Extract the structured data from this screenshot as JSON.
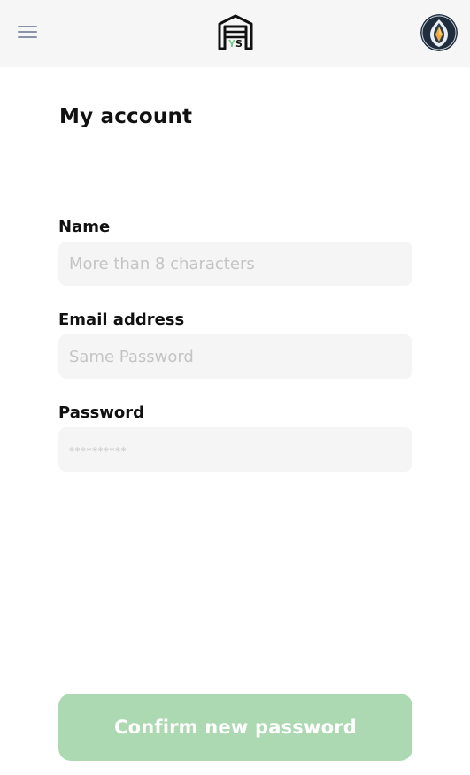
{
  "header": {
    "menu_icon": "hamburger-menu-icon",
    "logo_icon": "garage-ys-logo",
    "avatar_icon": "profile-avatar",
    "logo_text": "YS"
  },
  "page": {
    "title": "My account"
  },
  "form": {
    "name": {
      "label": "Name",
      "placeholder": "More than 8 characters"
    },
    "email": {
      "label": "Email address",
      "placeholder": "Same Password"
    },
    "password": {
      "label": "Password",
      "placeholder": "**********"
    }
  },
  "actions": {
    "confirm_label": "Confirm new password"
  },
  "colors": {
    "header_bg": "#f6f6f6",
    "input_bg": "#f5f5f5",
    "button_bg": "#acd9b2",
    "logo_accent": "#7fc98c",
    "avatar_bg": "#1f2d3d"
  }
}
